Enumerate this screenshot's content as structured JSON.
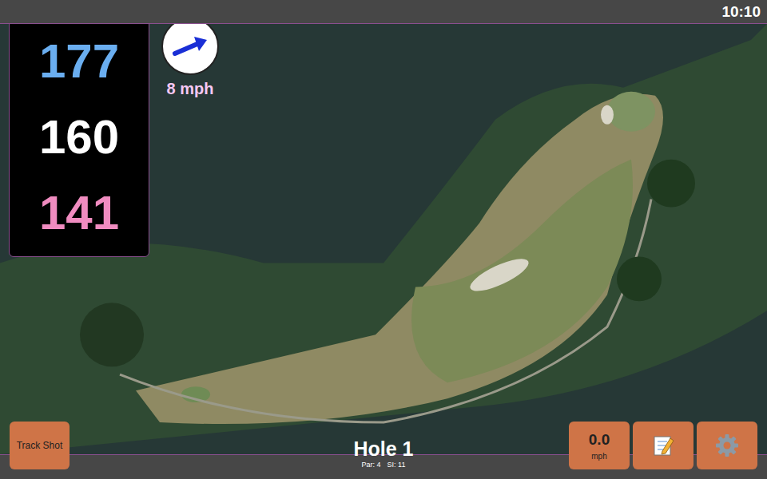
{
  "status_bar": {
    "time": "10:10"
  },
  "distances": [
    {
      "value": "177",
      "color": "#6aaef0"
    },
    {
      "value": "160",
      "color": "#ffffff"
    },
    {
      "value": "141",
      "color": "#f08cc0"
    }
  ],
  "wind": {
    "speed": "8 mph"
  },
  "hole": {
    "title": "Hole 1",
    "par": "Par: 4",
    "si": "SI: 11"
  },
  "buttons": {
    "track_shot": "Track Shot",
    "speed": "0.0",
    "speed_unit": "mph"
  }
}
